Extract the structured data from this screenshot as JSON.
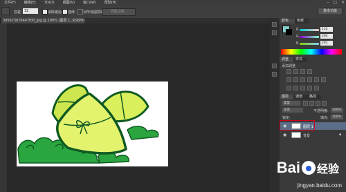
{
  "menubar": {
    "items": [
      "文件(F)",
      "编辑(E)",
      "3D(D)",
      "视图(V)",
      "窗口(W)",
      "帮助(H)"
    ]
  },
  "options": {
    "tolerance_label": "容差:",
    "tolerance_value": "32",
    "antialias_label": "消除锯齿",
    "contiguous_label": "连续",
    "sample_all_label": "对所有图层取样",
    "refine_edge_label": "调整边缘...",
    "workspace_label": "基本功能"
  },
  "document": {
    "tab_title": "3d5673b76447f00_jpg @ 100% (图层 1, RGB/8#) *"
  },
  "color_panel": {
    "tab_label": "颜色",
    "swatches_label": "色板",
    "r_value": "132",
    "g_value": "204",
    "b_value": "201"
  },
  "adjustments_panel": {
    "tab_label": "调整",
    "styles_label": "样式",
    "add_label": "添加调整"
  },
  "layers_panel": {
    "tab_label": "图层",
    "channels_label": "通道",
    "paths_label": "路径",
    "kind_label": "类型",
    "blend_mode": "正常",
    "opacity_label": "不透明度:",
    "opacity_value": "100%",
    "lock_label": "锁定:",
    "fill_label": "填充:",
    "fill_value": "100%",
    "layers": [
      {
        "name": "图层 1",
        "selected": true
      },
      {
        "name": "背景",
        "selected": false
      }
    ]
  },
  "watermark": {
    "logo_text": "Bai",
    "logo_text2": "经验",
    "url": "jingyan.baidu.com"
  },
  "colors": {
    "accent": "#d0021b",
    "zongzi_light": "#d9ef5c",
    "zongzi_dark": "#0f5a22",
    "cloud": "#2aa53f"
  }
}
